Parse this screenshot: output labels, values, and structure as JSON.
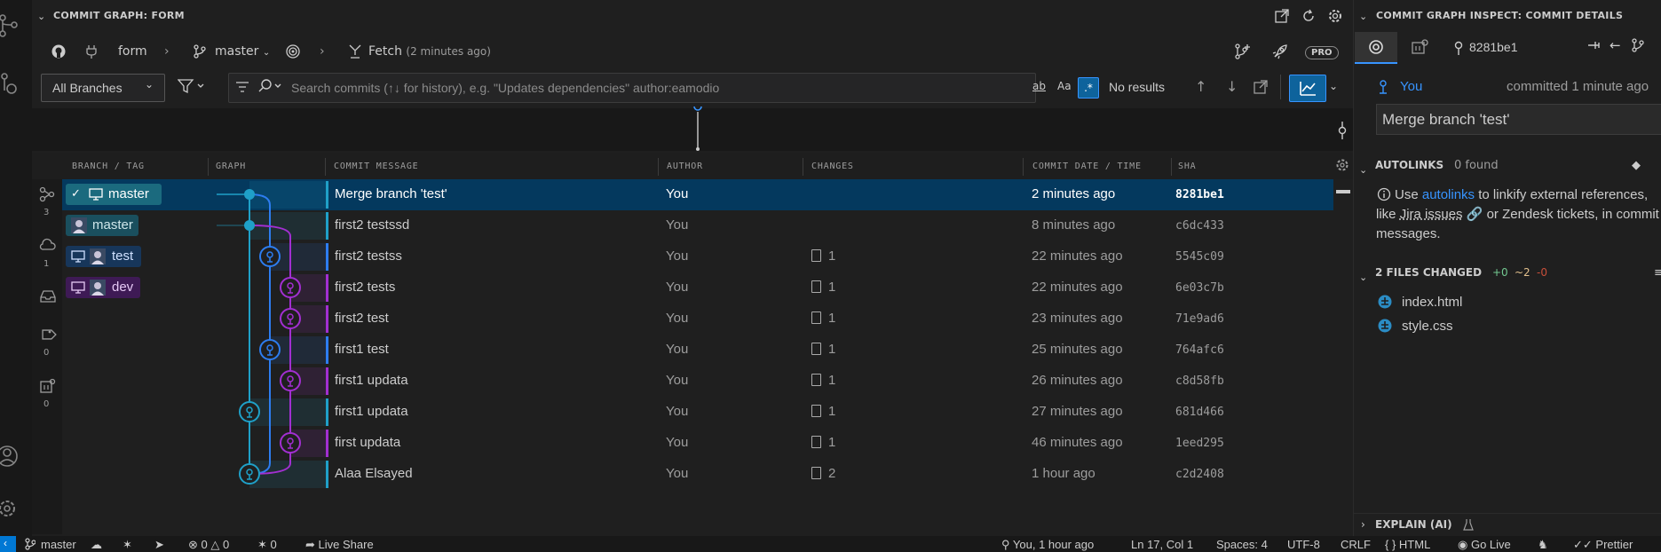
{
  "panel": {
    "title": "COMMIT GRAPH: FORM"
  },
  "toolbar": {
    "repo": "form",
    "branch": "master",
    "fetch_label": "Fetch",
    "fetch_time": "(2 minutes ago)",
    "pro_badge": "PRO"
  },
  "filter": {
    "branches_select": "All Branches",
    "search_placeholder": "Search commits (↑↓ for history), e.g. \"Updates dependencies\" author:eamodio",
    "match_word": "ab",
    "match_case": "Aa",
    "regex": ".*",
    "results": "No results"
  },
  "columns": {
    "branch": "BRANCH / TAG",
    "graph": "GRAPH",
    "message": "COMMIT MESSAGE",
    "author": "AUTHOR",
    "changes": "CHANGES",
    "date": "COMMIT DATE / TIME",
    "sha": "SHA"
  },
  "gutter": {
    "branches_count": "3",
    "remotes_count": "1",
    "tags_count": "0",
    "worktrees_count": "0"
  },
  "refs": {
    "r0": "master",
    "r1": "master",
    "r2": "test",
    "r3": "dev"
  },
  "commits": [
    {
      "message": "Merge branch 'test'",
      "author": "You",
      "changes": "",
      "date": "2 minutes ago",
      "sha": "8281be1"
    },
    {
      "message": "first2 testssd",
      "author": "You",
      "changes": "",
      "date": "8 minutes ago",
      "sha": "c6dc433"
    },
    {
      "message": "first2 testss",
      "author": "You",
      "changes": "1",
      "date": "22 minutes ago",
      "sha": "5545c09"
    },
    {
      "message": "first2 tests",
      "author": "You",
      "changes": "1",
      "date": "22 minutes ago",
      "sha": "6e03c7b"
    },
    {
      "message": "first2 test",
      "author": "You",
      "changes": "1",
      "date": "23 minutes ago",
      "sha": "71e9ad6"
    },
    {
      "message": "first1 test",
      "author": "You",
      "changes": "1",
      "date": "25 minutes ago",
      "sha": "764afc6"
    },
    {
      "message": "first1 updata",
      "author": "You",
      "changes": "1",
      "date": "26 minutes ago",
      "sha": "c8d58fb"
    },
    {
      "message": "first1 updata",
      "author": "You",
      "changes": "1",
      "date": "27 minutes ago",
      "sha": "681d466"
    },
    {
      "message": "first updata",
      "author": "You",
      "changes": "1",
      "date": "46 minutes ago",
      "sha": "1eed295"
    },
    {
      "message": "Alaa Elsayed",
      "author": "You",
      "changes": "2",
      "date": "1 hour ago",
      "sha": "c2d2408"
    }
  ],
  "inspect": {
    "title": "COMMIT GRAPH INSPECT: COMMIT DETAILS",
    "sha": "8281be1",
    "author": "You",
    "committed": "committed 1 minute ago",
    "message": "Merge branch 'test'",
    "autolinks_title": "AUTOLINKS",
    "autolinks_count": "0 found",
    "autolinks_text1": "Use",
    "autolinks_link": "autolinks",
    "autolinks_text2": "to linkify external",
    "autolinks_text3": "references, like",
    "autolinks_jira": "Jira issues",
    "autolinks_text4": "or Zendesk",
    "autolinks_text5": "tickets, in commit messages.",
    "files_title": "2 FILES CHANGED",
    "files_added": "+0",
    "files_modified": "~2",
    "files_deleted": "-0",
    "files": [
      "index.html",
      "style.css"
    ],
    "explain_title": "EXPLAIN (AI)"
  },
  "statusbar": {
    "branch": "master",
    "errors": "0",
    "warnings": "0",
    "ports": "0",
    "liveshare": "Live Share",
    "blame": "You, 1 hour ago",
    "position": "Ln 17, Col 1",
    "spaces": "Spaces: 4",
    "encoding": "UTF-8",
    "eol": "CRLF",
    "language": "HTML",
    "golive": "Go Live",
    "prettier": "Prettier"
  },
  "colors": {
    "lane_master": "#1fa0c8",
    "lane_test": "#2d7df0",
    "lane_dev": "#a22fd1",
    "selected_row": "#04395e",
    "accent": "#0078d4"
  }
}
